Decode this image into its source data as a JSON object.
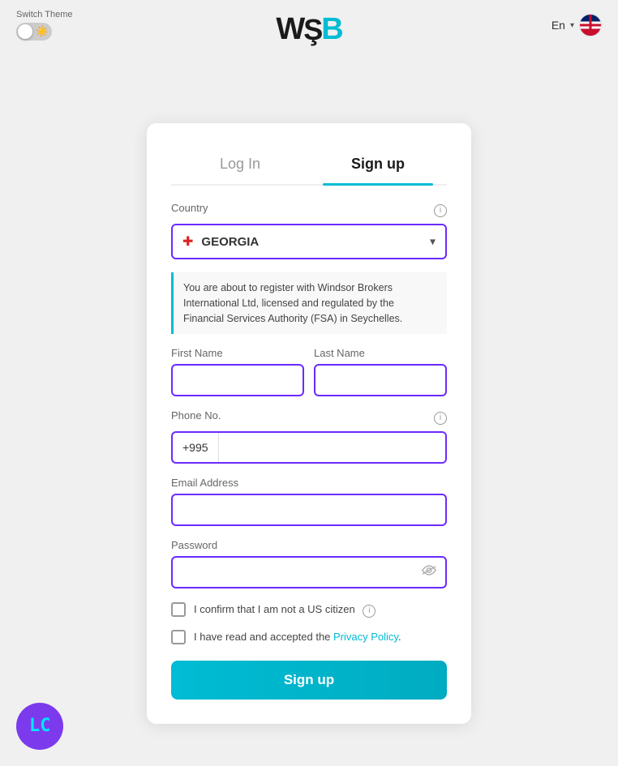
{
  "header": {
    "switch_theme_label": "Switch Theme",
    "logo": "WB",
    "lang": "En",
    "toggle_emoji": "☀️"
  },
  "tabs": {
    "login": "Log In",
    "signup": "Sign up"
  },
  "form": {
    "country_label": "Country",
    "country_value": "GEORGIA",
    "notice": "You are about to register with Windsor Brokers International Ltd, licensed and regulated by the Financial Services Authority (FSA) in Seychelles.",
    "first_name_label": "First Name",
    "last_name_label": "Last Name",
    "phone_label": "Phone No.",
    "phone_prefix": "+995",
    "email_label": "Email Address",
    "password_label": "Password",
    "check1_label": "I confirm that I am not a US citizen",
    "check2_before": "I have read and accepted the ",
    "check2_link": "Privacy Policy",
    "check2_after": ".",
    "signup_btn": "Sign up"
  },
  "bottom": {
    "logo_text": "LC"
  }
}
